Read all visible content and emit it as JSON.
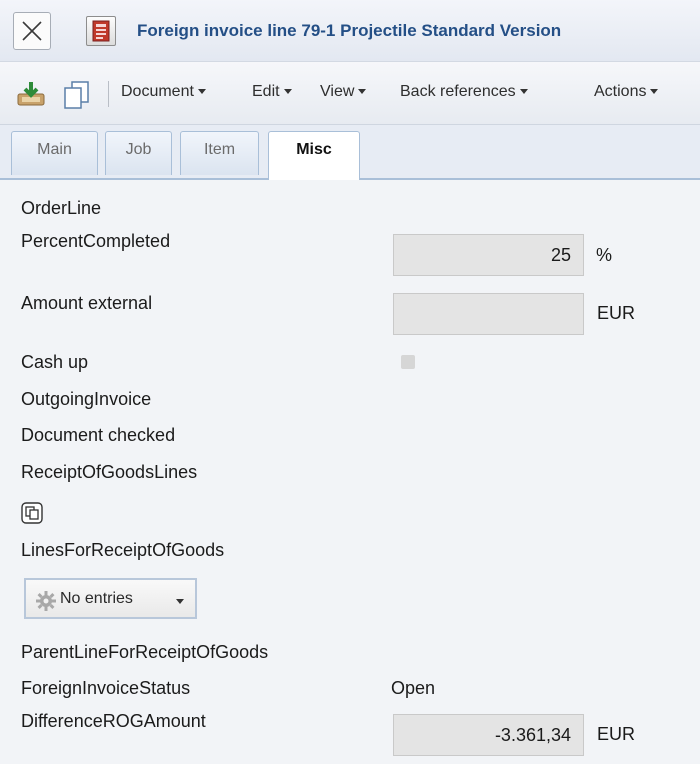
{
  "window": {
    "title": "Foreign invoice line 79-1 Projectile Standard Version"
  },
  "toolbar": {
    "menus": [
      "Document",
      "Edit",
      "View",
      "Back references",
      "Actions"
    ]
  },
  "tabs": [
    {
      "label": "Main",
      "active": false
    },
    {
      "label": "Job",
      "active": false
    },
    {
      "label": "Item",
      "active": false
    },
    {
      "label": "Misc",
      "active": true
    }
  ],
  "form": {
    "order_line": {
      "label": "OrderLine"
    },
    "percent_completed": {
      "label": "PercentCompleted",
      "value": "25",
      "unit": "%"
    },
    "amount_external": {
      "label": "Amount external",
      "value": "",
      "unit": "EUR"
    },
    "cash_up": {
      "label": "Cash up",
      "checked": false
    },
    "outgoing_invoice": {
      "label": "OutgoingInvoice"
    },
    "document_checked": {
      "label": "Document checked"
    },
    "receipt_of_goods_lines": {
      "label": "ReceiptOfGoodsLines"
    },
    "lines_for_receipt_of_goods": {
      "label": "LinesForReceiptOfGoods",
      "button_label": "No entries"
    },
    "parent_line_for_receipt_of_goods": {
      "label": "ParentLineForReceiptOfGoods"
    },
    "foreign_invoice_status": {
      "label": "ForeignInvoiceStatus",
      "value": "Open"
    },
    "difference_rog_amount": {
      "label": "DifferenceROGAmount",
      "value": "-3.361,34",
      "unit": "EUR"
    }
  },
  "icons": {
    "close": "close-icon",
    "document": "document-icon",
    "download": "download-icon",
    "copy": "copy-icon",
    "gear": "gear-icon"
  },
  "colors": {
    "title": "#244f86",
    "tab_border": "#a9bfd8",
    "field_bg": "#e4e4e4"
  }
}
